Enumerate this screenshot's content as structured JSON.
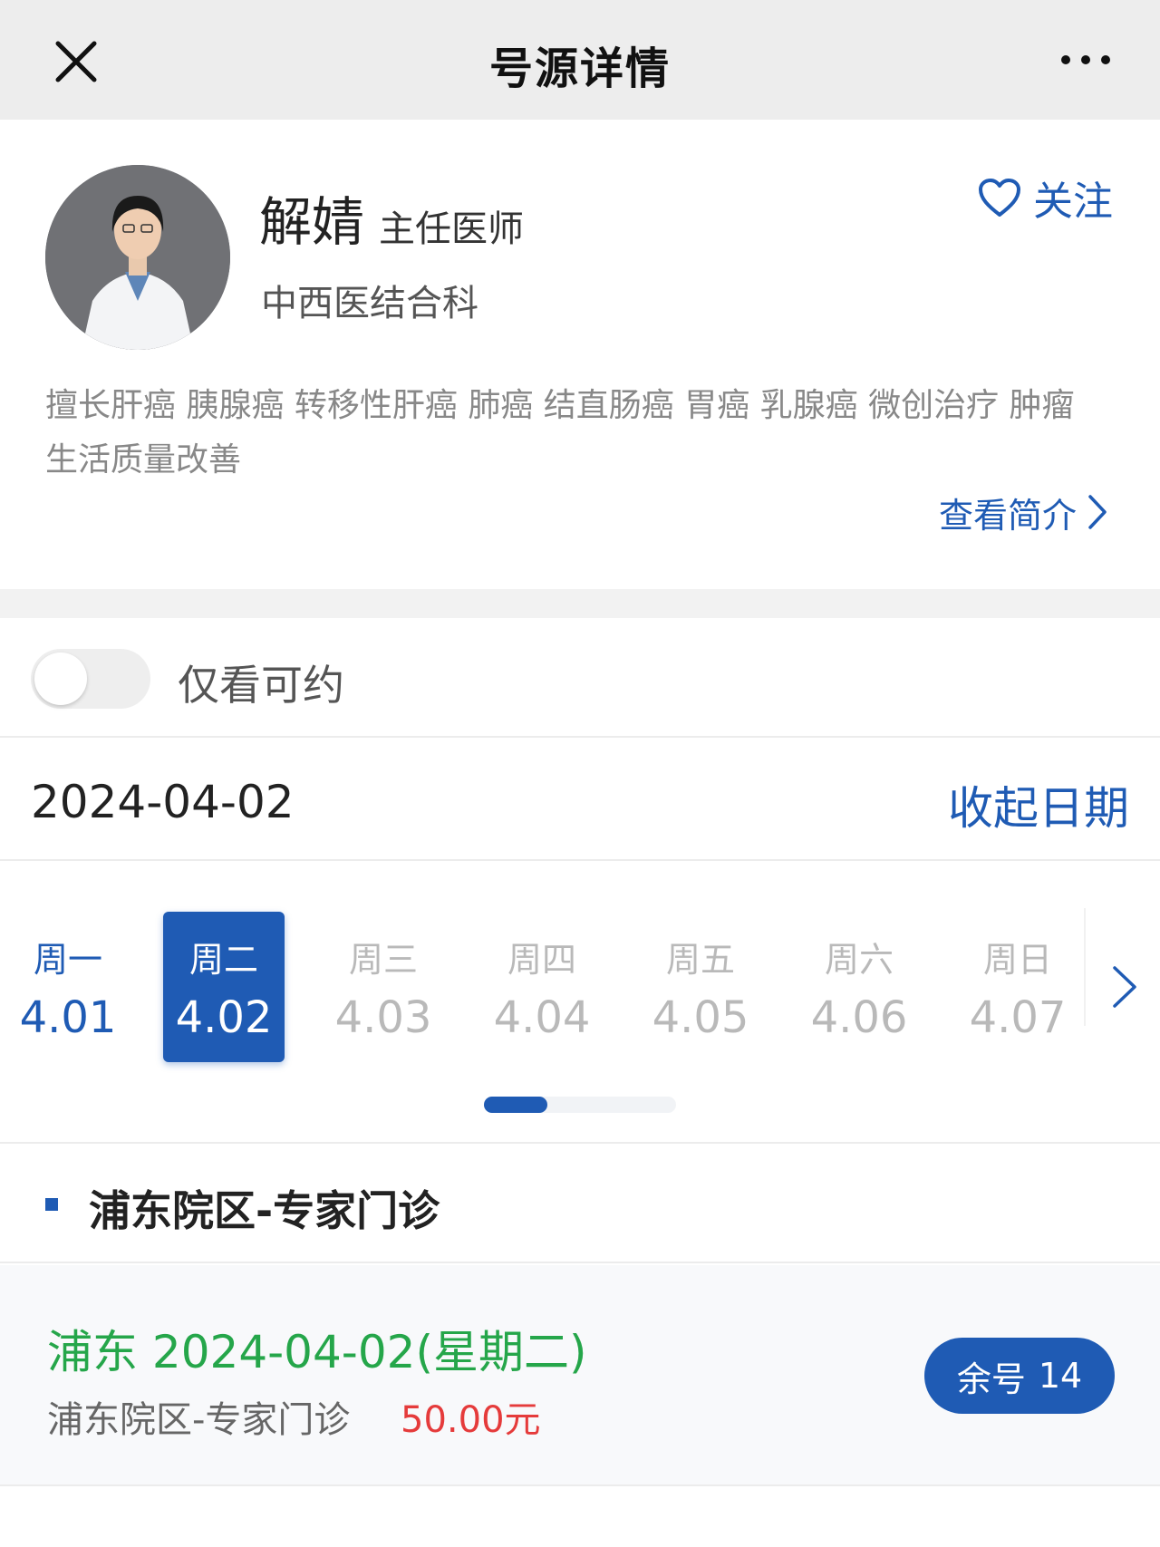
{
  "nav": {
    "title": "号源详情",
    "close_icon": "close-icon",
    "more_icon": "more-dots-icon"
  },
  "doctor": {
    "name": "解婧",
    "title": "主任医师",
    "department": "中西医结合科",
    "follow_label": "关注",
    "follow_icon": "heart-outline-icon",
    "specialty": "擅长肝癌 胰腺癌 转移性肝癌 肺癌 结直肠癌 胃癌 乳腺癌 微创治疗 肿瘤生活质量改善",
    "view_intro_label": "查看简介"
  },
  "filter": {
    "toggle_label": "仅看可约",
    "toggle_on": false
  },
  "date_bar": {
    "current_date": "2024-04-02",
    "collapse_label": "收起日期"
  },
  "week": {
    "days": [
      {
        "week": "周一",
        "date": "4.01",
        "state": "available"
      },
      {
        "week": "周二",
        "date": "4.02",
        "state": "selected"
      },
      {
        "week": "周三",
        "date": "4.03",
        "state": "unavailable"
      },
      {
        "week": "周四",
        "date": "4.04",
        "state": "unavailable"
      },
      {
        "week": "周五",
        "date": "4.05",
        "state": "unavailable"
      },
      {
        "week": "周六",
        "date": "4.06",
        "state": "unavailable"
      },
      {
        "week": "周日",
        "date": "4.07",
        "state": "unavailable"
      }
    ],
    "scroll_progress": 0.33
  },
  "section": {
    "title": "浦东院区-专家门诊"
  },
  "slot": {
    "title": "浦东 2024-04-02(星期二)",
    "subtitle": "浦东院区-专家门诊",
    "price": "50.00元",
    "remain_label": "余号",
    "remain_count": "14"
  },
  "colors": {
    "primary": "#1f5bb4",
    "green": "#25a64a",
    "price_red": "#e53b3b"
  }
}
